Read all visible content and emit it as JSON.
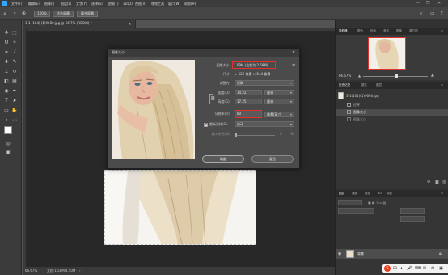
{
  "menubar": {
    "items": [
      "文件(F)",
      "编辑(E)",
      "图像(I)",
      "图层(L)",
      "文字(Y)",
      "选择(S)",
      "滤镜(T)",
      "3D(D)",
      "视图(V)",
      "增效工具",
      "窗口(W)",
      "帮助(H)"
    ],
    "window_controls": [
      "—",
      "❐",
      "✕"
    ]
  },
  "options": {
    "zoom_value": "100%",
    "fit_screen": "适合屏幕",
    "fill_screen": "填充屏幕"
  },
  "document": {
    "tab_title": "3-1 (104) (1)9600.jpg @ 66.7% (RGB/8) *",
    "zoom_status": "66.67%",
    "doc_status": "文档:1.50M/1.50M"
  },
  "dialog": {
    "title": "图像大小",
    "image_size_label": "图像大小:",
    "image_size_value": "1.09M (之前为 2.69M)",
    "dimensions_label": "尺寸:",
    "dimensions_value": "⌄ 526 像素 × 644 像素",
    "fit_label": "调整为:",
    "fit_value": "原稿",
    "width_label": "宽度(D):",
    "width_value": "14.22",
    "width_unit": "厘米",
    "height_label": "高度(G):",
    "height_value": "17.25",
    "height_unit": "厘米",
    "resolution_label": "分辨率(R):",
    "resolution_value": "80",
    "resolution_unit": "像素/英寸",
    "resample_label": "重新采样(S):",
    "resample_value": "自动",
    "reduce_noise_label": "减少杂色(N):",
    "reduce_noise_value": "0",
    "reduce_noise_unit": "%",
    "ok_label": "确定",
    "cancel_label": "复位"
  },
  "navigator": {
    "tabs": [
      "导航器",
      "颜色",
      "色板",
      "渐变",
      "图案",
      "直方图"
    ],
    "zoom": "66.67%"
  },
  "history": {
    "tabs": [
      "历史记录",
      "属性",
      "图层"
    ],
    "snapshot": "3-1(104)(1)9600.jpg",
    "items": [
      "打开",
      "图像大小",
      "图像大小"
    ]
  },
  "layers": {
    "tabs": [
      "图层",
      "通道",
      "路径",
      "3D",
      "调整"
    ],
    "layer_name": "背景"
  },
  "taskbar_icons": [
    "S",
    "中",
    "•",
    "🎤",
    "⌨",
    "✉",
    "⚙",
    "▣"
  ],
  "colors": {
    "accent": "#31a8ff",
    "highlight_red": "#e0322c"
  }
}
